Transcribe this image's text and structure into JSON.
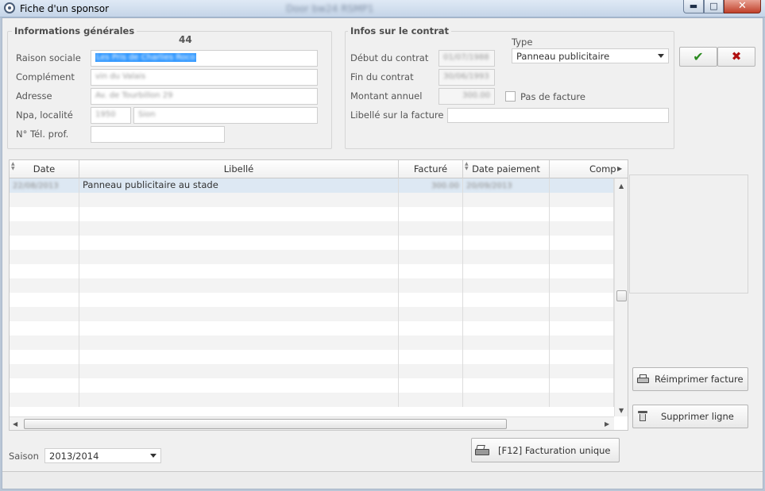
{
  "window": {
    "title": "Fiche d'un sponsor",
    "background_title": "Door bw24 RSMP1",
    "close_glyph": "✕",
    "minimize_glyph": "▬",
    "maximize_glyph": "□"
  },
  "general": {
    "title": "Informations générales",
    "id": "44",
    "raison_sociale_label": "Raison sociale",
    "raison_sociale_value": "Les Pris de Charlies Roco",
    "complement_label": "Complément",
    "complement_value": "vin du Valais",
    "adresse_label": "Adresse",
    "adresse_value": "Av. de Tourbillon 29",
    "npa_label": "Npa, localité",
    "npa_value": "1950",
    "localite_value": "Sion",
    "tel_label": "N° Tél. prof.",
    "tel_value": ""
  },
  "contract": {
    "title": "Infos sur le contrat",
    "type_label": "Type",
    "type_value": "Panneau publicitaire",
    "debut_label": "Début du contrat",
    "debut_value": "01/07/1988",
    "fin_label": "Fin du contrat",
    "fin_value": "30/06/1993",
    "montant_label": "Montant annuel",
    "montant_value": "300.00",
    "pas_facture_label": "Pas de facture",
    "pas_facture_checked": false,
    "libelle_label": "Libellé sur la facture",
    "libelle_value": ""
  },
  "actions": {
    "ok_icon": "✔",
    "cancel_icon": "✖",
    "reprint_label": "Réimprimer facture",
    "delete_label": "Supprimer ligne",
    "billing_label": "[F12] Facturation unique",
    "colors": {
      "ok": "#2a8a1f",
      "cancel": "#b01010"
    }
  },
  "table": {
    "columns": [
      "Date",
      "Libellé",
      "Facturé",
      "Date paiement",
      "Comp"
    ],
    "rows": [
      {
        "date": "22/08/2013",
        "libelle": "Panneau publicitaire au stade",
        "facture": "300.00",
        "date_paiement": "20/09/2013",
        "comp": ""
      }
    ]
  },
  "saison": {
    "label": "Saison",
    "value": "2013/2014"
  }
}
